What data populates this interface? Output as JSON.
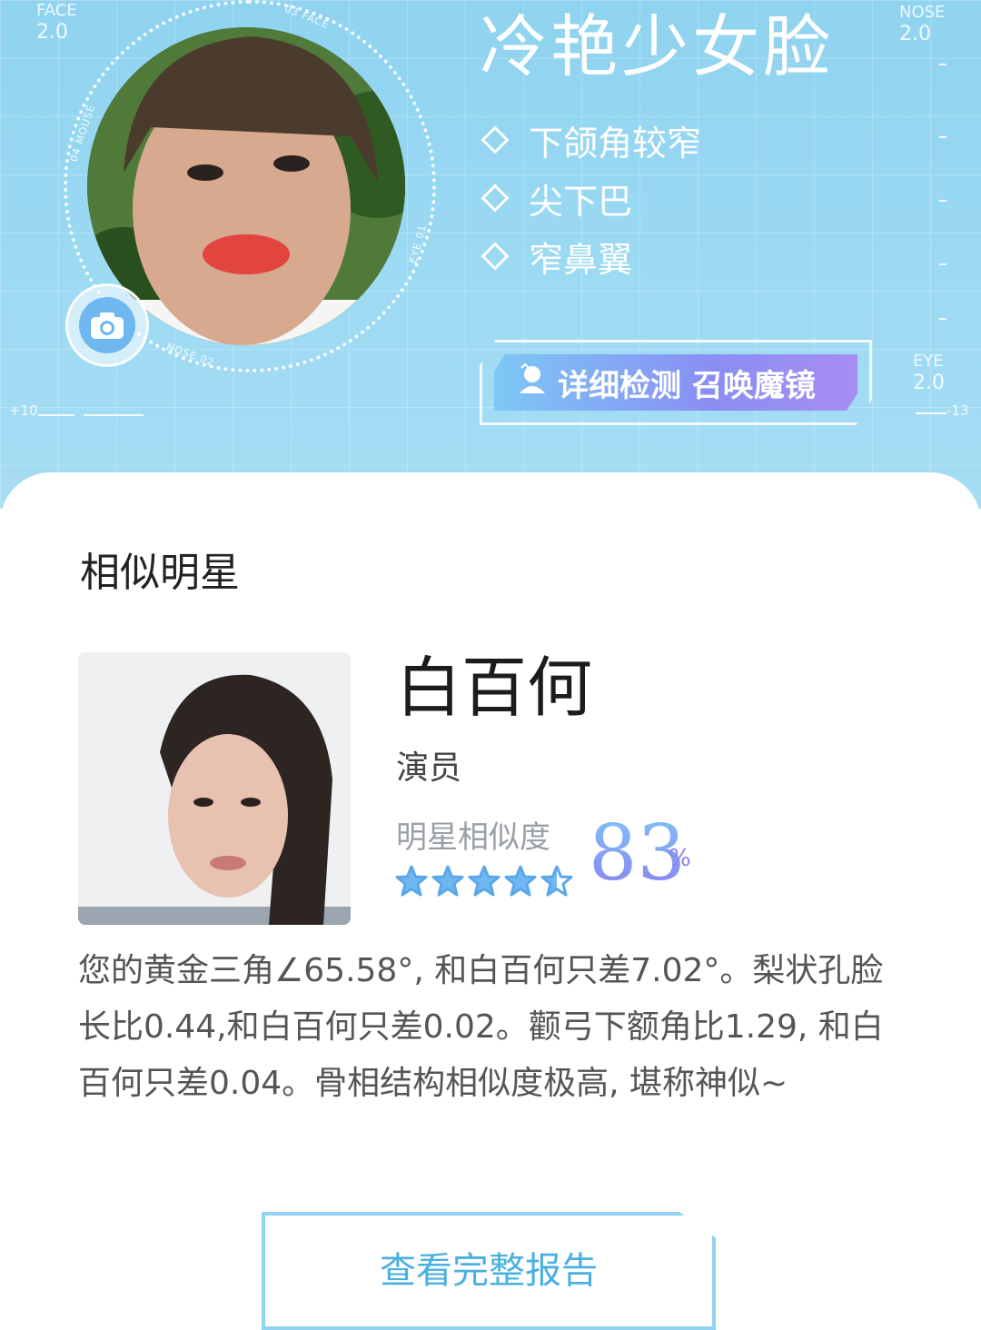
{
  "hero": {
    "corner_tl_top": "FACE",
    "corner_tl_bottom": "2.0",
    "corner_tr_top": "NOSE",
    "corner_tr_bottom": "2.0",
    "corner_br_top": "EYE",
    "corner_br_bottom": "2.0",
    "scale_left": "+10",
    "scale_right": "-13",
    "ring_labels": [
      "03 FACE",
      "04 MOUSE",
      "EYE 01",
      "NOSE 02"
    ],
    "face_type": "冷艳少女脸",
    "features": [
      "下颌角较窄",
      "尖下巴",
      "窄鼻翼"
    ],
    "detail_button": "详细检测 召唤魔镜"
  },
  "similar": {
    "section_title": "相似明星",
    "name": "白百何",
    "role": "演员",
    "similarity_label": "明星相似度",
    "similarity_value": "83",
    "similarity_unit": "%",
    "rating": 4.5,
    "rating_max": 5,
    "description": "您的黄金三角∠65.58°, 和白百何只差7.02°。梨状孔脸长比0.44,和白百何只差0.02。颧弓下额角比1.29, 和白百何只差0.04。骨相结构相似度极高, 堪称神似~",
    "report_button": "查看完整报告"
  },
  "colors": {
    "hero_blue": "#9edaf3",
    "accent_purple": "#8a7ff0",
    "accent_blue": "#4ab0e0"
  }
}
